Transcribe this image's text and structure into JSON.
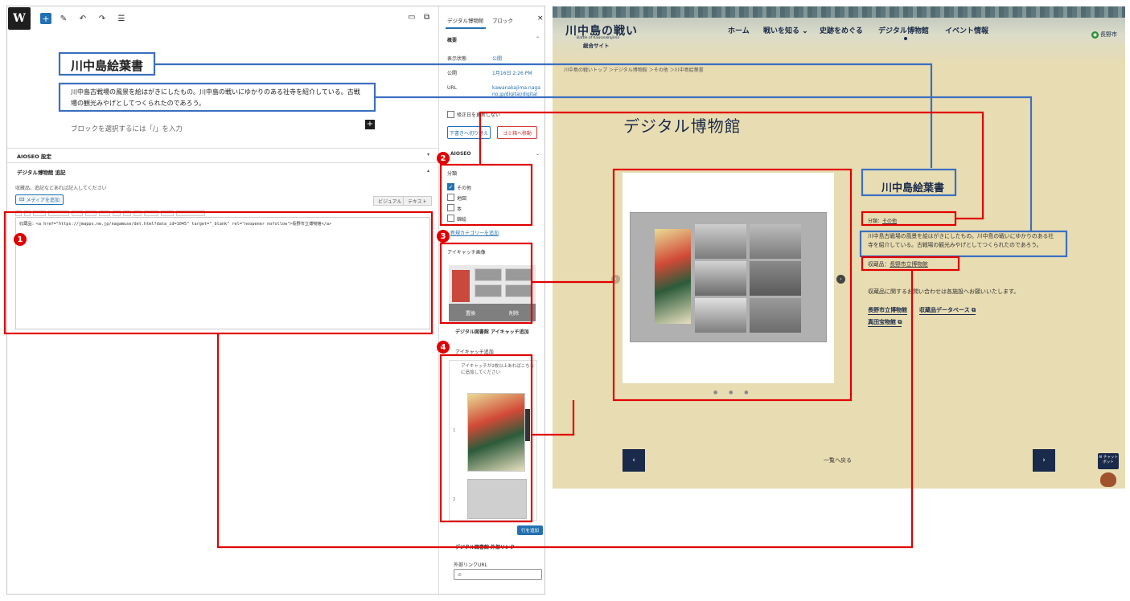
{
  "editor": {
    "toolbar": {
      "logo": "W",
      "add": "+",
      "edit": "✎",
      "undo": "↶",
      "redo": "↷",
      "list": "☰",
      "view": "▭",
      "preview": "⧉"
    },
    "post_title": "川中島絵葉書",
    "post_desc": "川中島古戦場の風景を絵はがきにしたもの。川中島の戦いにゆかりのある社寺を紹介している。古戦場の観光みやげとしてつくられたのであろう。",
    "block_placeholder": "ブロックを選択するには「/」を入力",
    "block_plus": "+",
    "aioseo_label": "AIOSEO 設定",
    "extra_label": "デジタル博物館 追記",
    "extra_note": "収蔵品、追記などあれば記入してください",
    "media_button": "メディアを追加",
    "tab_visual": "ビジュアル",
    "tab_text": "テキスト",
    "code": "収蔵品：<a href=\"https://jmapps.ne.jp/nagamuse/det.html?data_id=1045\" target=\"_blank\" rel=\"noopener nofollow\">長野市立博物館</a>"
  },
  "sidebar": {
    "tab_post": "デジタル博物館",
    "tab_block": "ブロック",
    "close": "×",
    "summary": "概要",
    "visibility_label": "表示状態",
    "visibility_value": "公開",
    "publish_label": "公開",
    "publish_value": "1月16日 2:26 PM",
    "url_label": "URL",
    "url_value": "kawanakajima.nagano.jp/digital/digital",
    "keep_date": "修正日を更新しない",
    "btn_draft": "下書きへ切り替え",
    "btn_trash": "ゴミ箱へ移動",
    "aioseo": "AIOSEO",
    "category_label": "分類",
    "categories": [
      {
        "label": "その他",
        "checked": true
      },
      {
        "label": "地図",
        "checked": false
      },
      {
        "label": "本",
        "checked": false
      },
      {
        "label": "錦絵",
        "checked": false
      }
    ],
    "add_category": "新規カテゴリーを追加",
    "featured_label": "アイキャッチ画像",
    "featured_replace": "置換",
    "featured_remove": "削除",
    "gallery_label": "デジタル図書館 アイキャッチ追加",
    "gallery_sub": "アイキャッチ追加",
    "gallery_note": "アイキャッチが2枚以上あればこちらに追加してください",
    "row1": "1",
    "row2": "2",
    "add_row": "行を追加",
    "links_label": "デジタル図書館 外部リンク",
    "ext_label": "外部リンクURL",
    "ext_icon": "⊘"
  },
  "site": {
    "logo_main": "川中島の戦い",
    "logo_en": "Battle of Kawanakajima",
    "logo_sub": "総合サイト",
    "nav": [
      "ホーム",
      "戦いを知る ⌄",
      "史跡をめぐる",
      "デジタル博物館",
      "イベント情報"
    ],
    "city": "長野市",
    "breadcrumb": "川中島の戦いトップ ＞デジタル博物館 ＞その他 ＞川中島絵葉書",
    "heading": "デジタル博物館",
    "title": "川中島絵葉書",
    "category_prefix": "分類：",
    "category": "その他",
    "description": "川中島古戦場の風景を絵はがきにしたもの。川中島の戦いにゆかりのある社寺を紹介している。古戦場の観光みやげとしてつくられたのであろう。",
    "holder_prefix": "収蔵品：",
    "holder": "長野市立博物館",
    "inquiry": "収蔵品に関するお問い合わせは各施設へお願いいたします。",
    "link1": "長野市立博物館",
    "link2": "収蔵品データベース ⧉",
    "link3": "真田宝物館 ⧉",
    "slider_next": "›",
    "slider_prev": "‹",
    "dots": "● ● ●",
    "pager_prev": "‹",
    "pager_next": "›",
    "back": "一覧へ戻る",
    "ai": "AI チャット ボット"
  },
  "badges": [
    "1",
    "2",
    "3",
    "4"
  ],
  "colors": {
    "red": "#e00000",
    "blue": "#3c6fc0",
    "wp_blue": "#2271b1",
    "navy": "#1a2a4a"
  }
}
